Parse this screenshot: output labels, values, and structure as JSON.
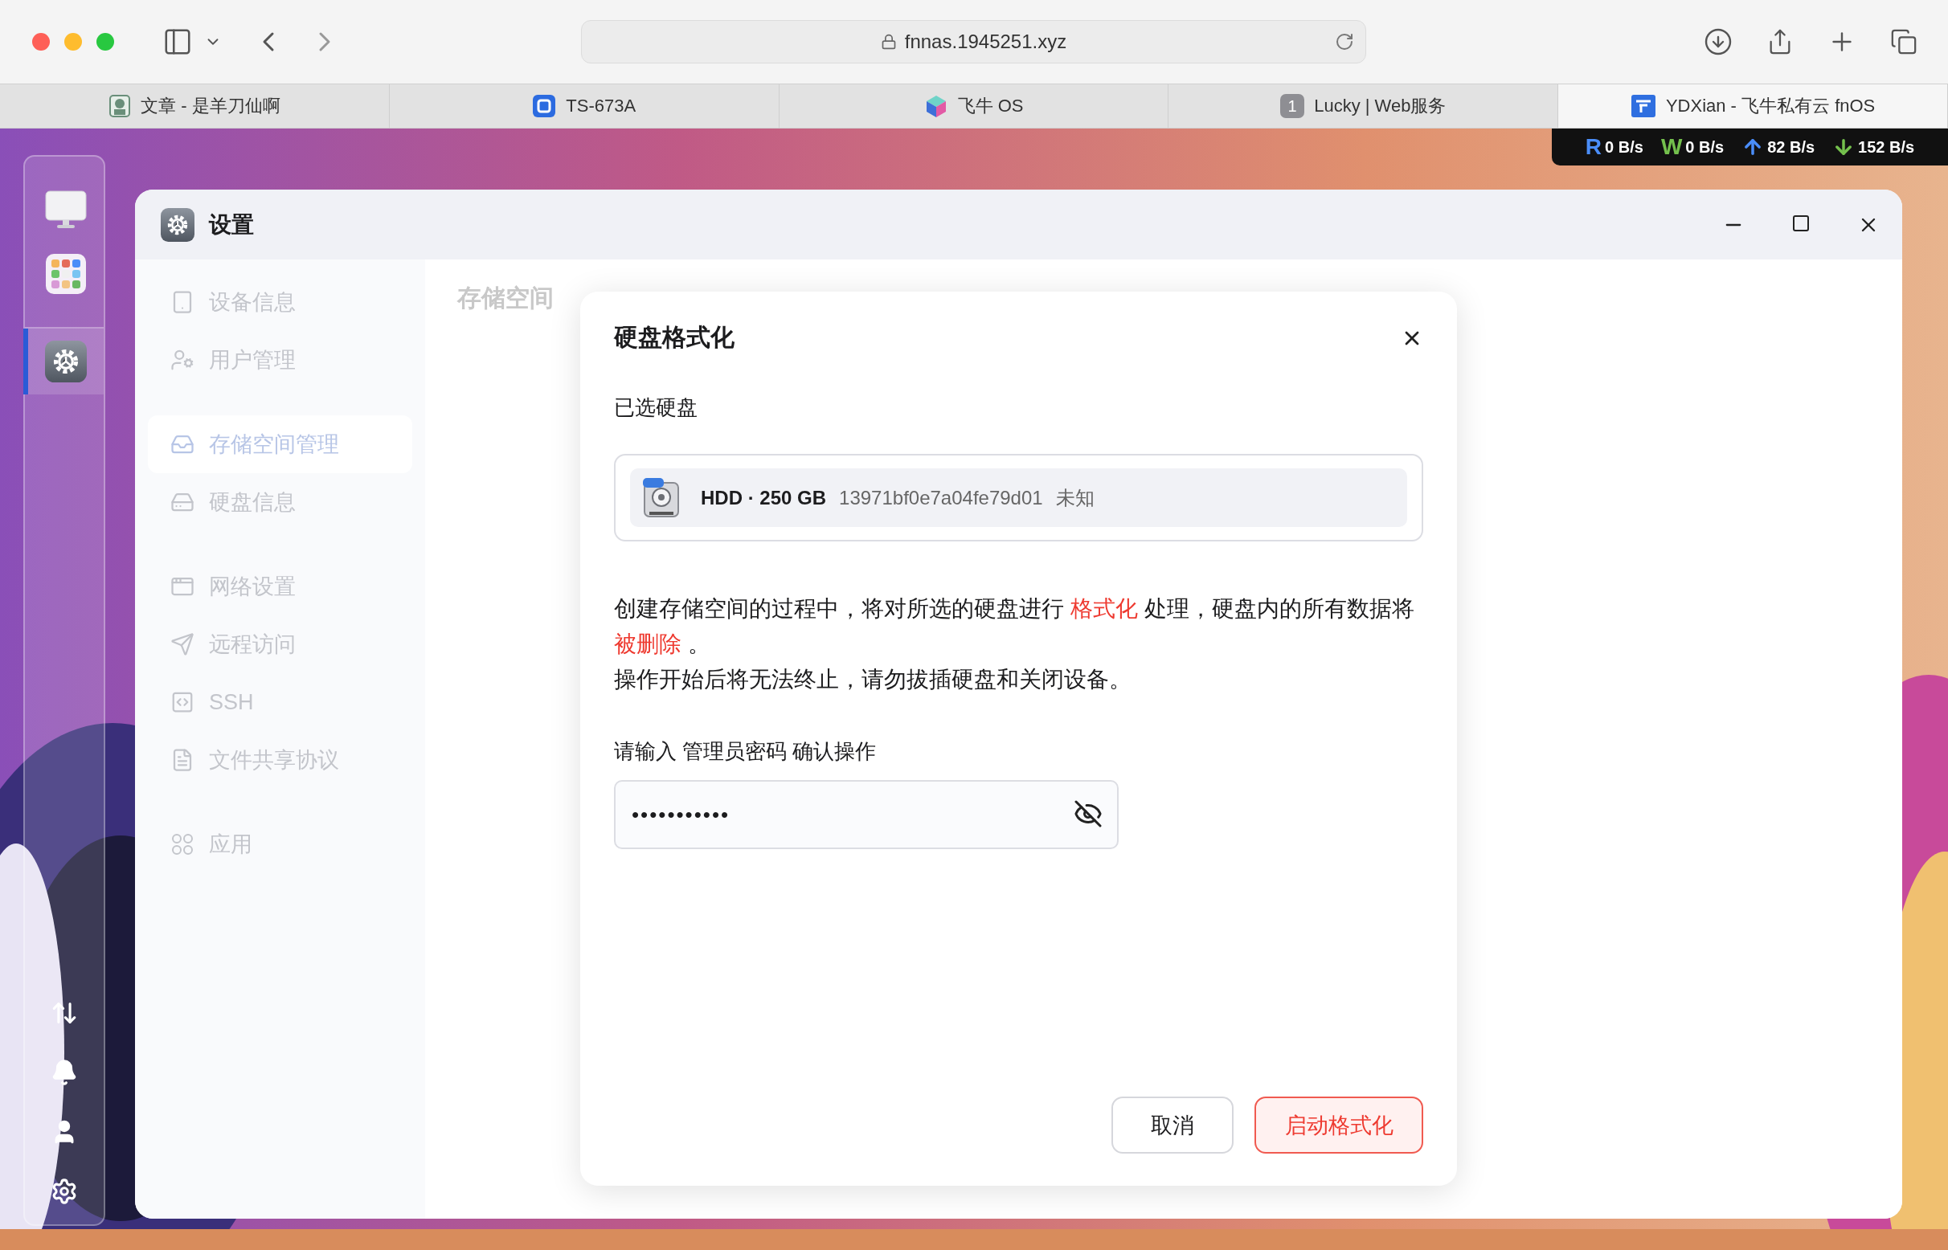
{
  "browser": {
    "url": "fnnas.1945251.xyz",
    "tabs": [
      {
        "title": "文章 - 是羊刀仙啊",
        "selected": false,
        "kind": "avatar"
      },
      {
        "title": "TS-673A",
        "selected": false,
        "kind": "square"
      },
      {
        "title": "飞牛 OS",
        "selected": false,
        "kind": "cube"
      },
      {
        "title": "Lucky | Web服务",
        "selected": false,
        "kind": "badge",
        "badge": "1"
      },
      {
        "title": "YDXian - 飞牛私有云 fnOS",
        "selected": true,
        "kind": "logo"
      }
    ]
  },
  "status_bar": [
    {
      "kind": "letter",
      "letter": "R",
      "value": "0 B/s",
      "color": "#4a8df8"
    },
    {
      "kind": "letter",
      "letter": "W",
      "value": "0 B/s",
      "color": "#74c04d"
    },
    {
      "kind": "upload",
      "value": "82 B/s",
      "color": "#4a8df8"
    },
    {
      "kind": "download",
      "value": "152 B/s",
      "color": "#74c04d"
    }
  ],
  "dock": {
    "apps": [
      {
        "kind": "monitor",
        "selected": false
      },
      {
        "kind": "apps",
        "selected": false
      },
      {
        "kind": "settings",
        "selected": true
      }
    ],
    "tools": [
      {
        "kind": "transfer"
      },
      {
        "kind": "bell"
      },
      {
        "kind": "user"
      },
      {
        "kind": "gear"
      }
    ]
  },
  "window": {
    "title": "设置",
    "content_title": "存储空间"
  },
  "nav": [
    {
      "items": [
        {
          "label": "设备信息",
          "kind": "device",
          "selected": false
        },
        {
          "label": "用户管理",
          "kind": "users",
          "selected": false
        }
      ]
    },
    {
      "items": [
        {
          "label": "存储空间管理",
          "kind": "storage",
          "selected": true
        },
        {
          "label": "硬盘信息",
          "kind": "disk",
          "selected": false
        }
      ]
    },
    {
      "items": [
        {
          "label": "网络设置",
          "kind": "network",
          "selected": false
        },
        {
          "label": "远程访问",
          "kind": "remote",
          "selected": false
        },
        {
          "label": "SSH",
          "kind": "code",
          "selected": false
        },
        {
          "label": "文件共享协议",
          "kind": "file",
          "selected": false
        }
      ]
    },
    {
      "items": [
        {
          "label": "应用",
          "kind": "apps",
          "selected": false
        }
      ]
    }
  ],
  "dialog": {
    "title": "硬盘格式化",
    "section_label": "已选硬盘",
    "disk": {
      "type": "HDD · 250 GB",
      "serial": "13971bf0e7a04fe79d01",
      "status": "未知"
    },
    "warning": [
      [
        {
          "text": "创建存储空间的过程中，将对所选的硬盘进行 ",
          "highlight": false
        },
        {
          "text": "格式化",
          "highlight": true
        },
        {
          "text": " 处理，硬盘内的所有数据将 ",
          "highlight": false
        },
        {
          "text": "被删除",
          "highlight": true
        },
        {
          "text": " 。",
          "highlight": false
        }
      ],
      [
        {
          "text": "操作开始后将无法终止，请勿拔插硬盘和关闭设备。",
          "highlight": false
        }
      ]
    ],
    "password": {
      "label": "请输入 管理员密码 确认操作",
      "value": "•••••••••••"
    },
    "buttons": [
      {
        "label": "取消",
        "kind": "secondary"
      },
      {
        "label": "启动格式化",
        "kind": "danger"
      }
    ]
  }
}
